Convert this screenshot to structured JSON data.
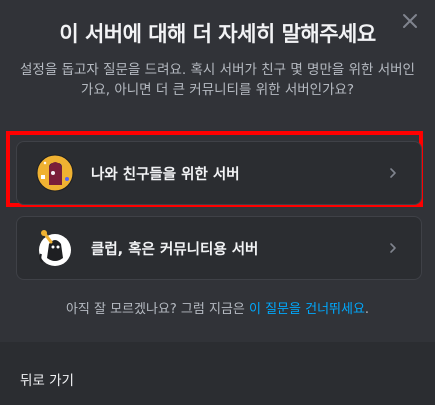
{
  "dialog": {
    "title": "이 서버에 대해 더 자세히 말해주세요",
    "subtitle": "설정을 돕고자 질문을 드려요. 혹시 서버가 친구 몇 명만을 위한 서버인가요, 아니면 더 큰 커뮤니티를 위한 서버인가요?"
  },
  "options": [
    {
      "label": "나와 친구들을 위한 서버",
      "icon": "friends-art-icon"
    },
    {
      "label": "클럽, 혹은 커뮤니티용 서버",
      "icon": "community-art-icon"
    }
  ],
  "hint": {
    "text": "아직 잘 모르겠나요? 그럼 지금은 ",
    "link": "이 질문을 건너뛰세요",
    "suffix": "."
  },
  "footer": {
    "back_label": "뒤로 가기"
  },
  "colors": {
    "background": "#313338",
    "card": "#2b2d31",
    "link": "#00a8fc",
    "highlight": "#ff0000"
  }
}
